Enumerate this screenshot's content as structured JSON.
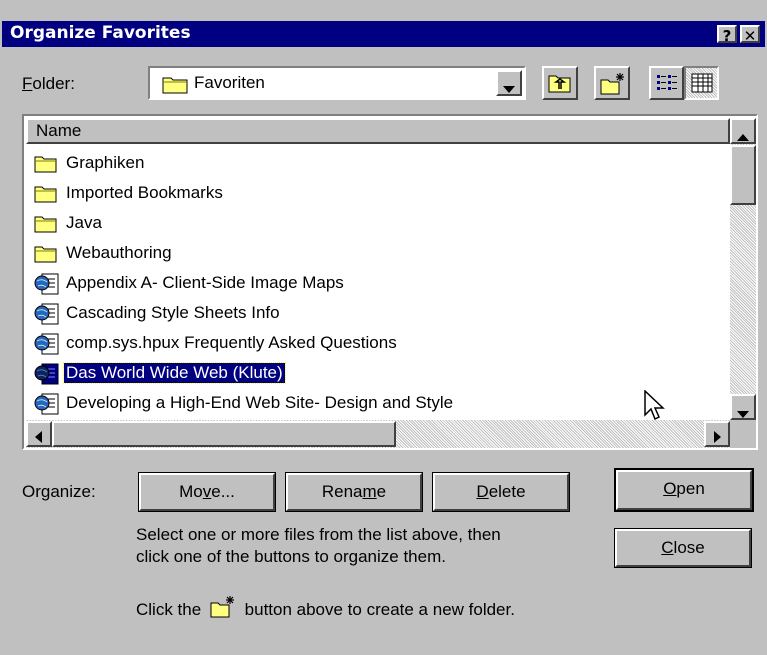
{
  "window": {
    "title": "Organize Favorites",
    "help_label": "?",
    "close_label": "✕"
  },
  "folder": {
    "label_mnemonic": "F",
    "label_rest": "older:",
    "selected": "Favoriten",
    "toolbar_icons": [
      "up-one-level-icon",
      "new-folder-icon",
      "list-view-icon",
      "details-view-icon"
    ]
  },
  "list": {
    "header": "Name",
    "items": [
      {
        "label": "Graphiken",
        "type": "folder"
      },
      {
        "label": "Imported Bookmarks",
        "type": "folder"
      },
      {
        "label": "Java",
        "type": "folder"
      },
      {
        "label": "Webauthoring",
        "type": "folder"
      },
      {
        "label": "Appendix A- Client-Side Image Maps",
        "type": "shortcut"
      },
      {
        "label": "Cascading Style Sheets Info",
        "type": "shortcut"
      },
      {
        "label": "comp.sys.hpux Frequently Asked Questions",
        "type": "shortcut"
      },
      {
        "label": "Das World Wide Web (Klute)",
        "type": "shortcut",
        "selected": true
      },
      {
        "label": "Developing a High-End Web Site- Design and Style",
        "type": "shortcut"
      }
    ]
  },
  "organize": {
    "label": "Organize:",
    "move_pre": "Mo",
    "move_ul": "v",
    "move_post": "e...",
    "rename_pre": "Rena",
    "rename_ul": "m",
    "rename_post": "e",
    "delete_ul": "D",
    "delete_post": "elete",
    "open_ul": "O",
    "open_post": "pen",
    "close_ul": "C",
    "close_post": "lose"
  },
  "help": {
    "line1": "Select one or more files from the list above, then",
    "line2": "click one of the buttons to organize them.",
    "line3_pre": "Click the",
    "line3_post": "button above to create a new folder."
  },
  "colors": {
    "titlebar": "#000080",
    "face": "#c0c0c0",
    "selection": "#000080",
    "folder": "#ffff80"
  }
}
